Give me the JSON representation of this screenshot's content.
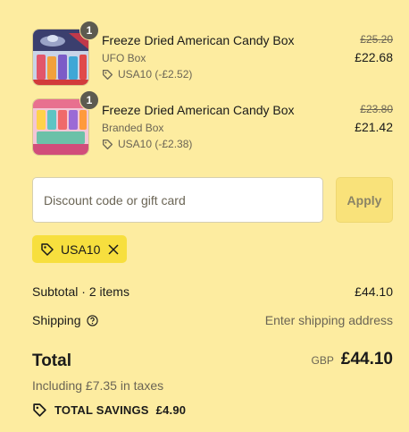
{
  "items": [
    {
      "quantity": "1",
      "title": "Freeze Dried American Candy Box",
      "variant": "UFO Box",
      "discount": "USA10 (-£2.52)",
      "original_price": "£25.20",
      "price": "£22.68"
    },
    {
      "quantity": "1",
      "title": "Freeze Dried American Candy Box",
      "variant": "Branded Box",
      "discount": "USA10 (-£2.38)",
      "original_price": "£23.80",
      "price": "£21.42"
    }
  ],
  "discount_form": {
    "placeholder": "Discount code or gift card",
    "apply_label": "Apply"
  },
  "applied_code": "USA10",
  "summary": {
    "subtotal_label": "Subtotal · 2 items",
    "subtotal_value": "£44.10",
    "shipping_label": "Shipping",
    "shipping_value": "Enter shipping address",
    "total_label": "Total",
    "currency": "GBP",
    "total_value": "£44.10",
    "taxes_note": "Including £7.35 in taxes",
    "savings_label": "TOTAL SAVINGS",
    "savings_value": "£4.90"
  },
  "colors": {
    "background": "#fdeca0",
    "code_chip": "#f7df3e",
    "apply_button": "#f9e27a"
  }
}
